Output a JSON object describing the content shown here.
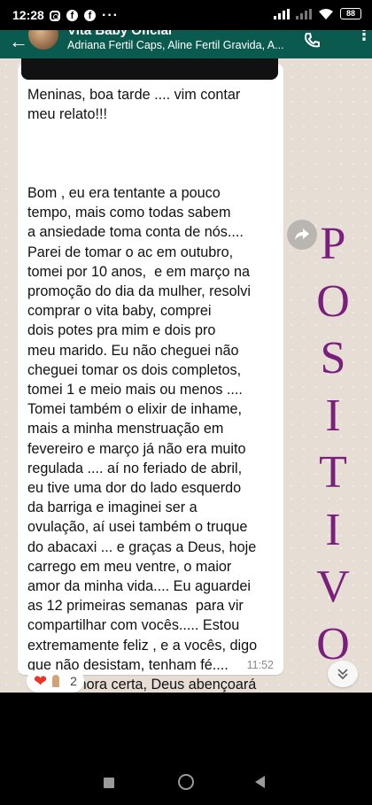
{
  "status_bar": {
    "time": "12:28",
    "battery": "88"
  },
  "header": {
    "title": "Vita Baby Oficial",
    "subtitle": "Adriana Fertil Caps, Aline Fertil Gravida, A..."
  },
  "message": {
    "text": "Meninas, boa tarde .... vim contar\nmeu relato!!!\n\n\n\nBom , eu era tentante a pouco\ntempo, mais como todas sabem\na ansiedade toma conta de nós....\nParei de tomar o ac em outubro,\ntomei por 10 anos,  e em março na\npromoção do dia da mulher, resolvi\ncomprar o vita baby, comprei\ndois potes pra mim e dois pro\nmeu marido. Eu não cheguei não\ncheguei tomar os dois completos,\ntomei 1 e meio mais ou menos ....\nTomei também o elixir de inhame,\nmais a minha menstruação em\nfevereiro e março já não era muito\nregulada .... aí no feriado de abril,\neu tive uma dor do lado esquerdo\nda barriga e imaginei ser a\novulação, aí usei também o truque\ndo abacaxi ... e graças a Deus, hoje\ncarrego em meu ventre, o maior\namor da minha vida.... Eu aguardei\nas 12 primeiras semanas  para vir\ncompartilhar com vocês..... Estou\nextremamente feliz , e a vocês, digo\nque não desistam, tenham fé....\nQue na hora certa, Deus abençoará\nvocês....",
    "time": "11:52",
    "reactions": {
      "emojis": [
        "heart",
        "praying-hands"
      ],
      "count": "2"
    }
  },
  "overlay_text": [
    "P",
    "O",
    "S",
    "I",
    "T",
    "I",
    "V",
    "O"
  ],
  "colors": {
    "header_bg": "#0b5a4f",
    "chat_bg": "#e6ded5",
    "overlay_text": "#7a1f7e"
  }
}
